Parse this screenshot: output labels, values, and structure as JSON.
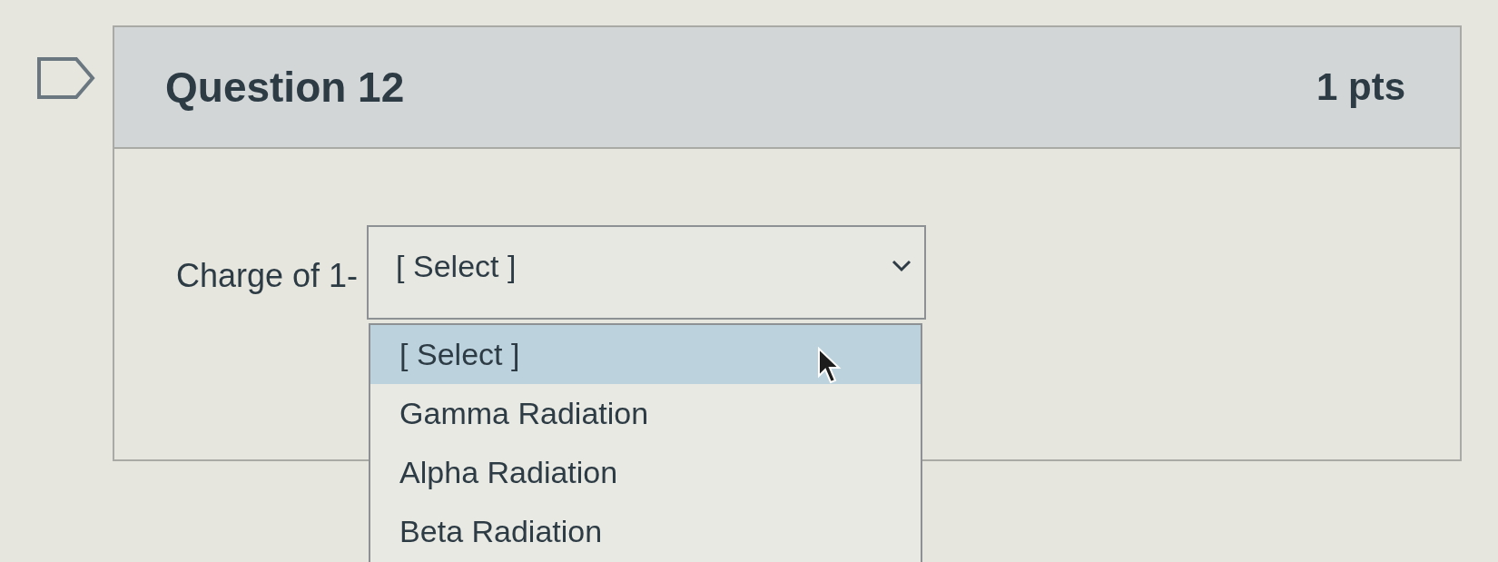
{
  "question": {
    "title": "Question 12",
    "points": "1 pts",
    "flagged": false
  },
  "prompt": "Charge of 1-",
  "dropdown": {
    "value": "[ Select ]",
    "expanded": true,
    "options": [
      {
        "label": "[ Select ]",
        "selected": true
      },
      {
        "label": "Gamma Radiation",
        "selected": false
      },
      {
        "label": "Alpha Radiation",
        "selected": false
      },
      {
        "label": "Beta Radiation",
        "selected": false
      }
    ]
  }
}
